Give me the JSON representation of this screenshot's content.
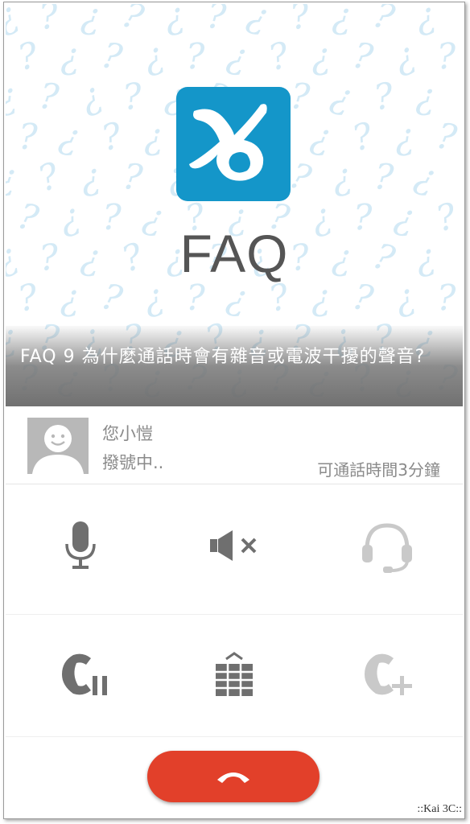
{
  "hero": {
    "title": "FAQ",
    "caption": "FAQ 9 為什麼通話時會有雜音或電波干擾的聲音?",
    "logo_color": "#1496c9",
    "pattern_glyph": "¿?"
  },
  "contact": {
    "name": "您小愷",
    "status": "撥號中..",
    "limit": "可通話時間3分鐘"
  },
  "controls": [
    {
      "icon": "microphone-icon",
      "state": "enabled"
    },
    {
      "icon": "speaker-mute-icon",
      "state": "enabled"
    },
    {
      "icon": "headset-icon",
      "state": "disabled"
    },
    {
      "icon": "hold-call-icon",
      "state": "enabled"
    },
    {
      "icon": "dialpad-icon",
      "state": "enabled"
    },
    {
      "icon": "add-call-icon",
      "state": "disabled"
    }
  ],
  "end_call": {
    "icon": "end-call-icon",
    "color": "#e2402a"
  },
  "watermark": "::Kai 3C::"
}
